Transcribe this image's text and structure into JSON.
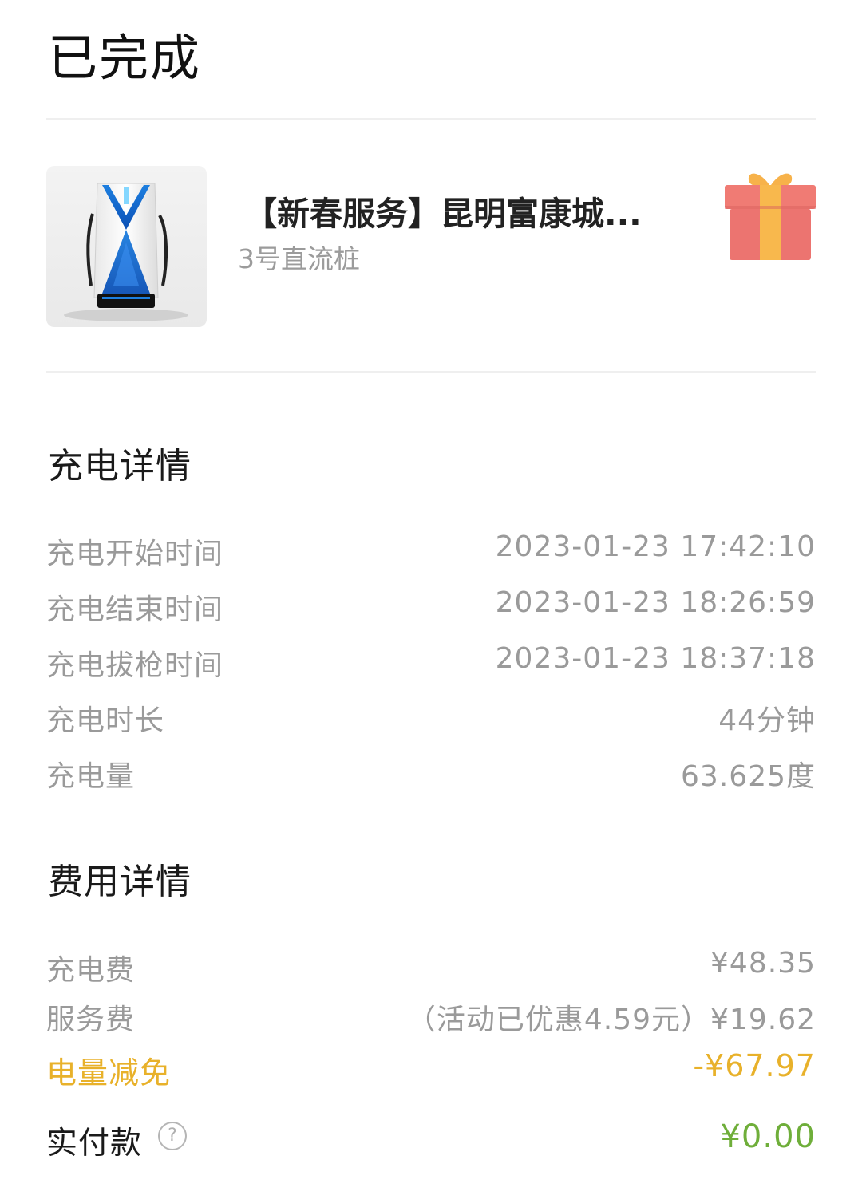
{
  "header": {
    "status": "已完成"
  },
  "station": {
    "name": "【新春服务】昆明富康城...",
    "pile": "3号直流桩",
    "thumbnail_icon": "charging-pile-image",
    "gift_icon": "gift-icon"
  },
  "charging_details": {
    "title": "充电详情",
    "rows": [
      {
        "label": "充电开始时间",
        "value": "2023-01-23 17:42:10"
      },
      {
        "label": "充电结束时间",
        "value": "2023-01-23 18:26:59"
      },
      {
        "label": "充电拔枪时间",
        "value": "2023-01-23 18:37:18"
      },
      {
        "label": "充电时长",
        "value": "44分钟"
      },
      {
        "label": "充电量",
        "value": "63.625度"
      }
    ]
  },
  "fee_details": {
    "title": "费用详情",
    "charge_fee": {
      "label": "充电费",
      "value": "¥48.35"
    },
    "service_fee": {
      "label": "服务费",
      "value": "（活动已优惠4.59元）¥19.62"
    },
    "discount": {
      "label": "电量减免",
      "value": "-¥67.97"
    },
    "actual_payment": {
      "label": "实付款",
      "value": "¥0.00",
      "help_icon": "?"
    }
  },
  "colors": {
    "discount": "#e8b12a",
    "actual_payment": "#6fae3a",
    "muted_text": "#9a9a9a"
  }
}
